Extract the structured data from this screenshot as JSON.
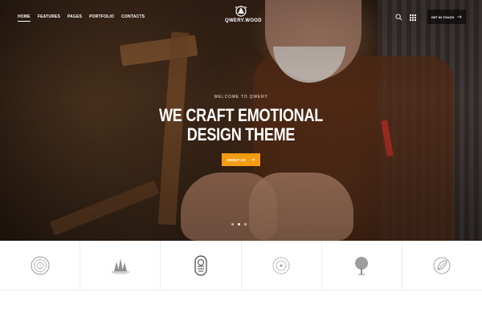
{
  "nav": {
    "items": [
      {
        "label": "Home",
        "active": true
      },
      {
        "label": "Features",
        "active": false
      },
      {
        "label": "Pages",
        "active": false
      },
      {
        "label": "Portfolio",
        "active": false
      },
      {
        "label": "Contacts",
        "active": false
      }
    ]
  },
  "logo": {
    "text": "QWERY.WOOD"
  },
  "header": {
    "get_in_touch_label": "Get in touch",
    "search_icon": "search-icon",
    "menu_icon": "grid-menu-icon"
  },
  "hero": {
    "kicker": "Welcome to Qwery",
    "headline_line1": "WE CRAFT EMOTIONAL",
    "headline_line2": "DESIGN THEME",
    "cta_label": "About us",
    "slides_count": 3,
    "active_slide": 2
  },
  "partners": {
    "icons": [
      "wood-ring-icon",
      "pine-forest-icon",
      "woodwork-badge-icon",
      "saw-blade-icon",
      "tree-icon",
      "leaf-emblem-icon"
    ]
  },
  "colors": {
    "accent": "#f39c12",
    "text_light": "#ffffff",
    "divider": "#ececec",
    "icon_grey": "#9a9a9a"
  }
}
